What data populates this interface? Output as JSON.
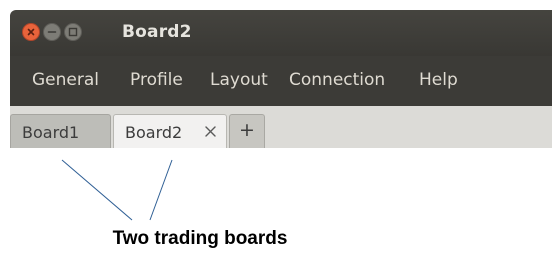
{
  "window": {
    "title": "Board2",
    "controls": [
      "close-icon",
      "minimize-icon",
      "maximize-icon"
    ]
  },
  "menu": {
    "items": [
      {
        "label": "General"
      },
      {
        "label": "Profile"
      },
      {
        "label": "Layout"
      },
      {
        "label": "Connection"
      },
      {
        "label": "Help"
      }
    ]
  },
  "tabs": [
    {
      "label": "Board1",
      "active": false
    },
    {
      "label": "Board2",
      "active": true,
      "closable": true
    }
  ],
  "add_tab": {
    "label": "+"
  },
  "annotation": {
    "caption": "Two trading boards"
  },
  "colors": {
    "titlebar": "#3e3d39",
    "menubar": "#3c3b37",
    "close_button": "#e8633b",
    "tab_active": "#f2f1f0",
    "tab_inactive": "#bdbdb8",
    "tabbar": "#dcdbd7",
    "annotation_line": "#2f5f95"
  }
}
